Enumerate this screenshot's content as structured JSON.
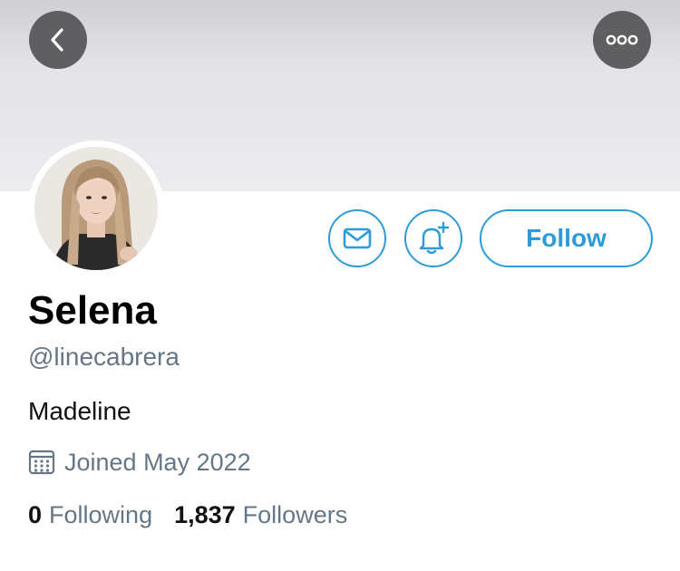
{
  "header": {
    "back_icon": "chevron-left-icon",
    "more_icon": "ellipsis-icon",
    "button_color": "#5f5f61"
  },
  "profile": {
    "name": "Selena",
    "handle": "@linecabrera",
    "bio": "Madeline",
    "joined": "Joined May 2022",
    "joined_icon": "calendar-icon"
  },
  "actions": {
    "message_icon": "envelope-icon",
    "notify_icon": "bell-plus-icon",
    "follow_label": "Follow",
    "accent_color": "#2d9bd9"
  },
  "stats": {
    "following_count": "0",
    "following_label": "Following",
    "followers_count": "1,837",
    "followers_label": "Followers"
  }
}
